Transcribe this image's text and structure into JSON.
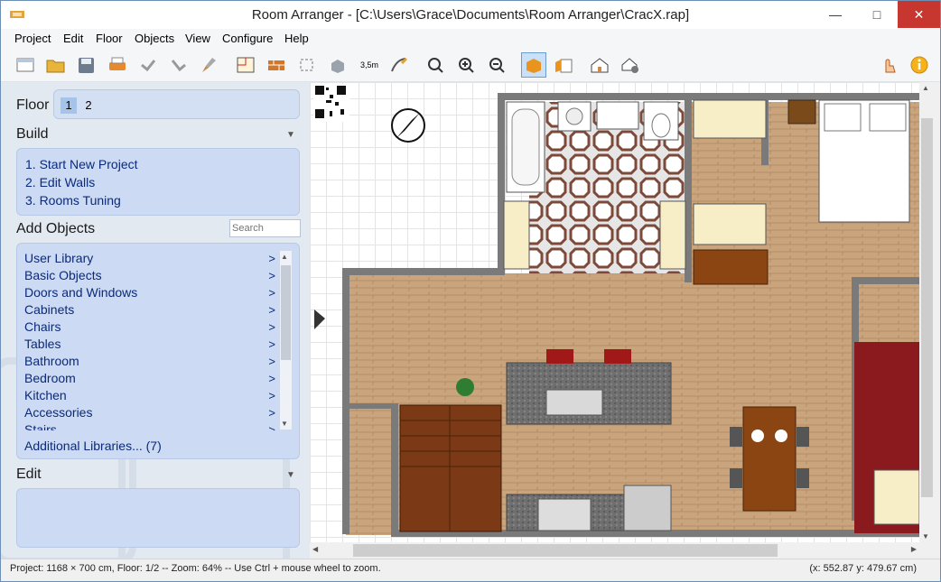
{
  "window": {
    "title": "Room Arranger - [C:\\Users\\Grace\\Documents\\Room Arranger\\CracX.rap]"
  },
  "menu": [
    "Project",
    "Edit",
    "Floor",
    "Objects",
    "View",
    "Configure",
    "Help"
  ],
  "toolbar": {
    "icons": [
      "new-project-icon",
      "open-folder-icon",
      "save-icon",
      "print-icon",
      "undo-icon",
      "redo-icon",
      "clean-brush-icon",
      "floor-plan-icon",
      "wall-icon",
      "select-corners-icon",
      "3d-object-icon",
      "measure-icon",
      "draw-line-icon",
      "zoom-fit-icon",
      "zoom-in-icon",
      "zoom-out-icon",
      "box-view-icon",
      "list-view-icon",
      "3d-house-icon",
      "render-settings-icon",
      "hand-icon",
      "info-icon"
    ],
    "measure_label": "3,5m"
  },
  "sidebar": {
    "floor_label": "Floor",
    "floors": [
      "1",
      "2"
    ],
    "build_label": "Build",
    "build_items": [
      "1. Start New Project",
      "2. Edit Walls",
      "3. Rooms Tuning"
    ],
    "add_objects_label": "Add Objects",
    "search_placeholder": "Search",
    "library_items": [
      "User Library",
      "Basic Objects",
      "Doors and Windows",
      "Cabinets",
      "Chairs",
      "Tables",
      "Bathroom",
      "Bedroom",
      "Kitchen",
      "Accessories",
      "Stairs"
    ],
    "additional_libraries": "Additional Libraries... (7)",
    "edit_label": "Edit",
    "arrow": ">"
  },
  "status": {
    "left": "Project: 1168 × 700 cm, Floor: 1/2 -- Zoom: 64% -- Use Ctrl + mouse wheel to zoom.",
    "right": "(x: 552.87 y: 479.67 cm)"
  },
  "colors": {
    "wood": "#c9a47c",
    "wall": "#7a7a7a",
    "countertop": "#6f6f6f",
    "stairs": "#7b3a15",
    "chair_red": "#a01818",
    "rug": "#8b1a1f"
  }
}
